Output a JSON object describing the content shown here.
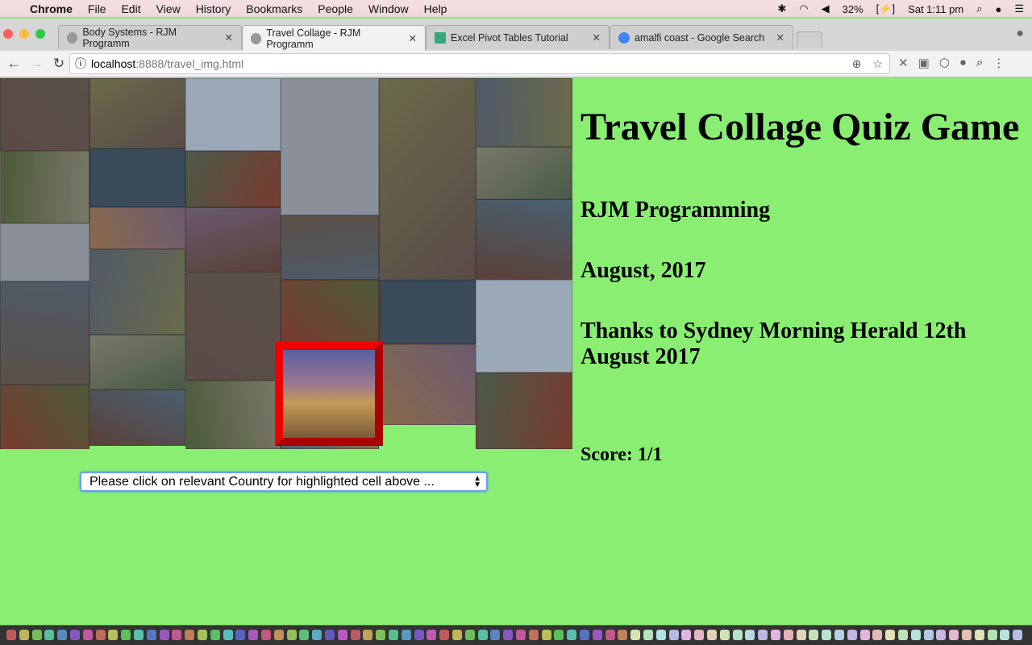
{
  "menubar": {
    "app": "Chrome",
    "items": [
      "File",
      "Edit",
      "View",
      "History",
      "Bookmarks",
      "People",
      "Window",
      "Help"
    ],
    "battery": "32%",
    "clock": "Sat 1:11 pm"
  },
  "tabs": [
    {
      "title": "Body Systems - RJM Programm",
      "active": false
    },
    {
      "title": "Travel Collage - RJM Programm",
      "active": true
    },
    {
      "title": "Excel Pivot Tables Tutorial",
      "active": false
    },
    {
      "title": "amalfi coast - Google Search",
      "active": false
    }
  ],
  "address": {
    "host": "localhost",
    "rest": ":8888/travel_img.html"
  },
  "page": {
    "title": "Travel Collage Quiz Game",
    "author": "RJM Programming",
    "date": "August, 2017",
    "thanks": "Thanks to Sydney Morning Herald 12th August 2017",
    "score": "Score: 1/1",
    "select_value": "Please click on relevant Country for highlighted cell above ..."
  },
  "colors": {
    "background": "#89ee72",
    "highlight": "#e00000"
  }
}
